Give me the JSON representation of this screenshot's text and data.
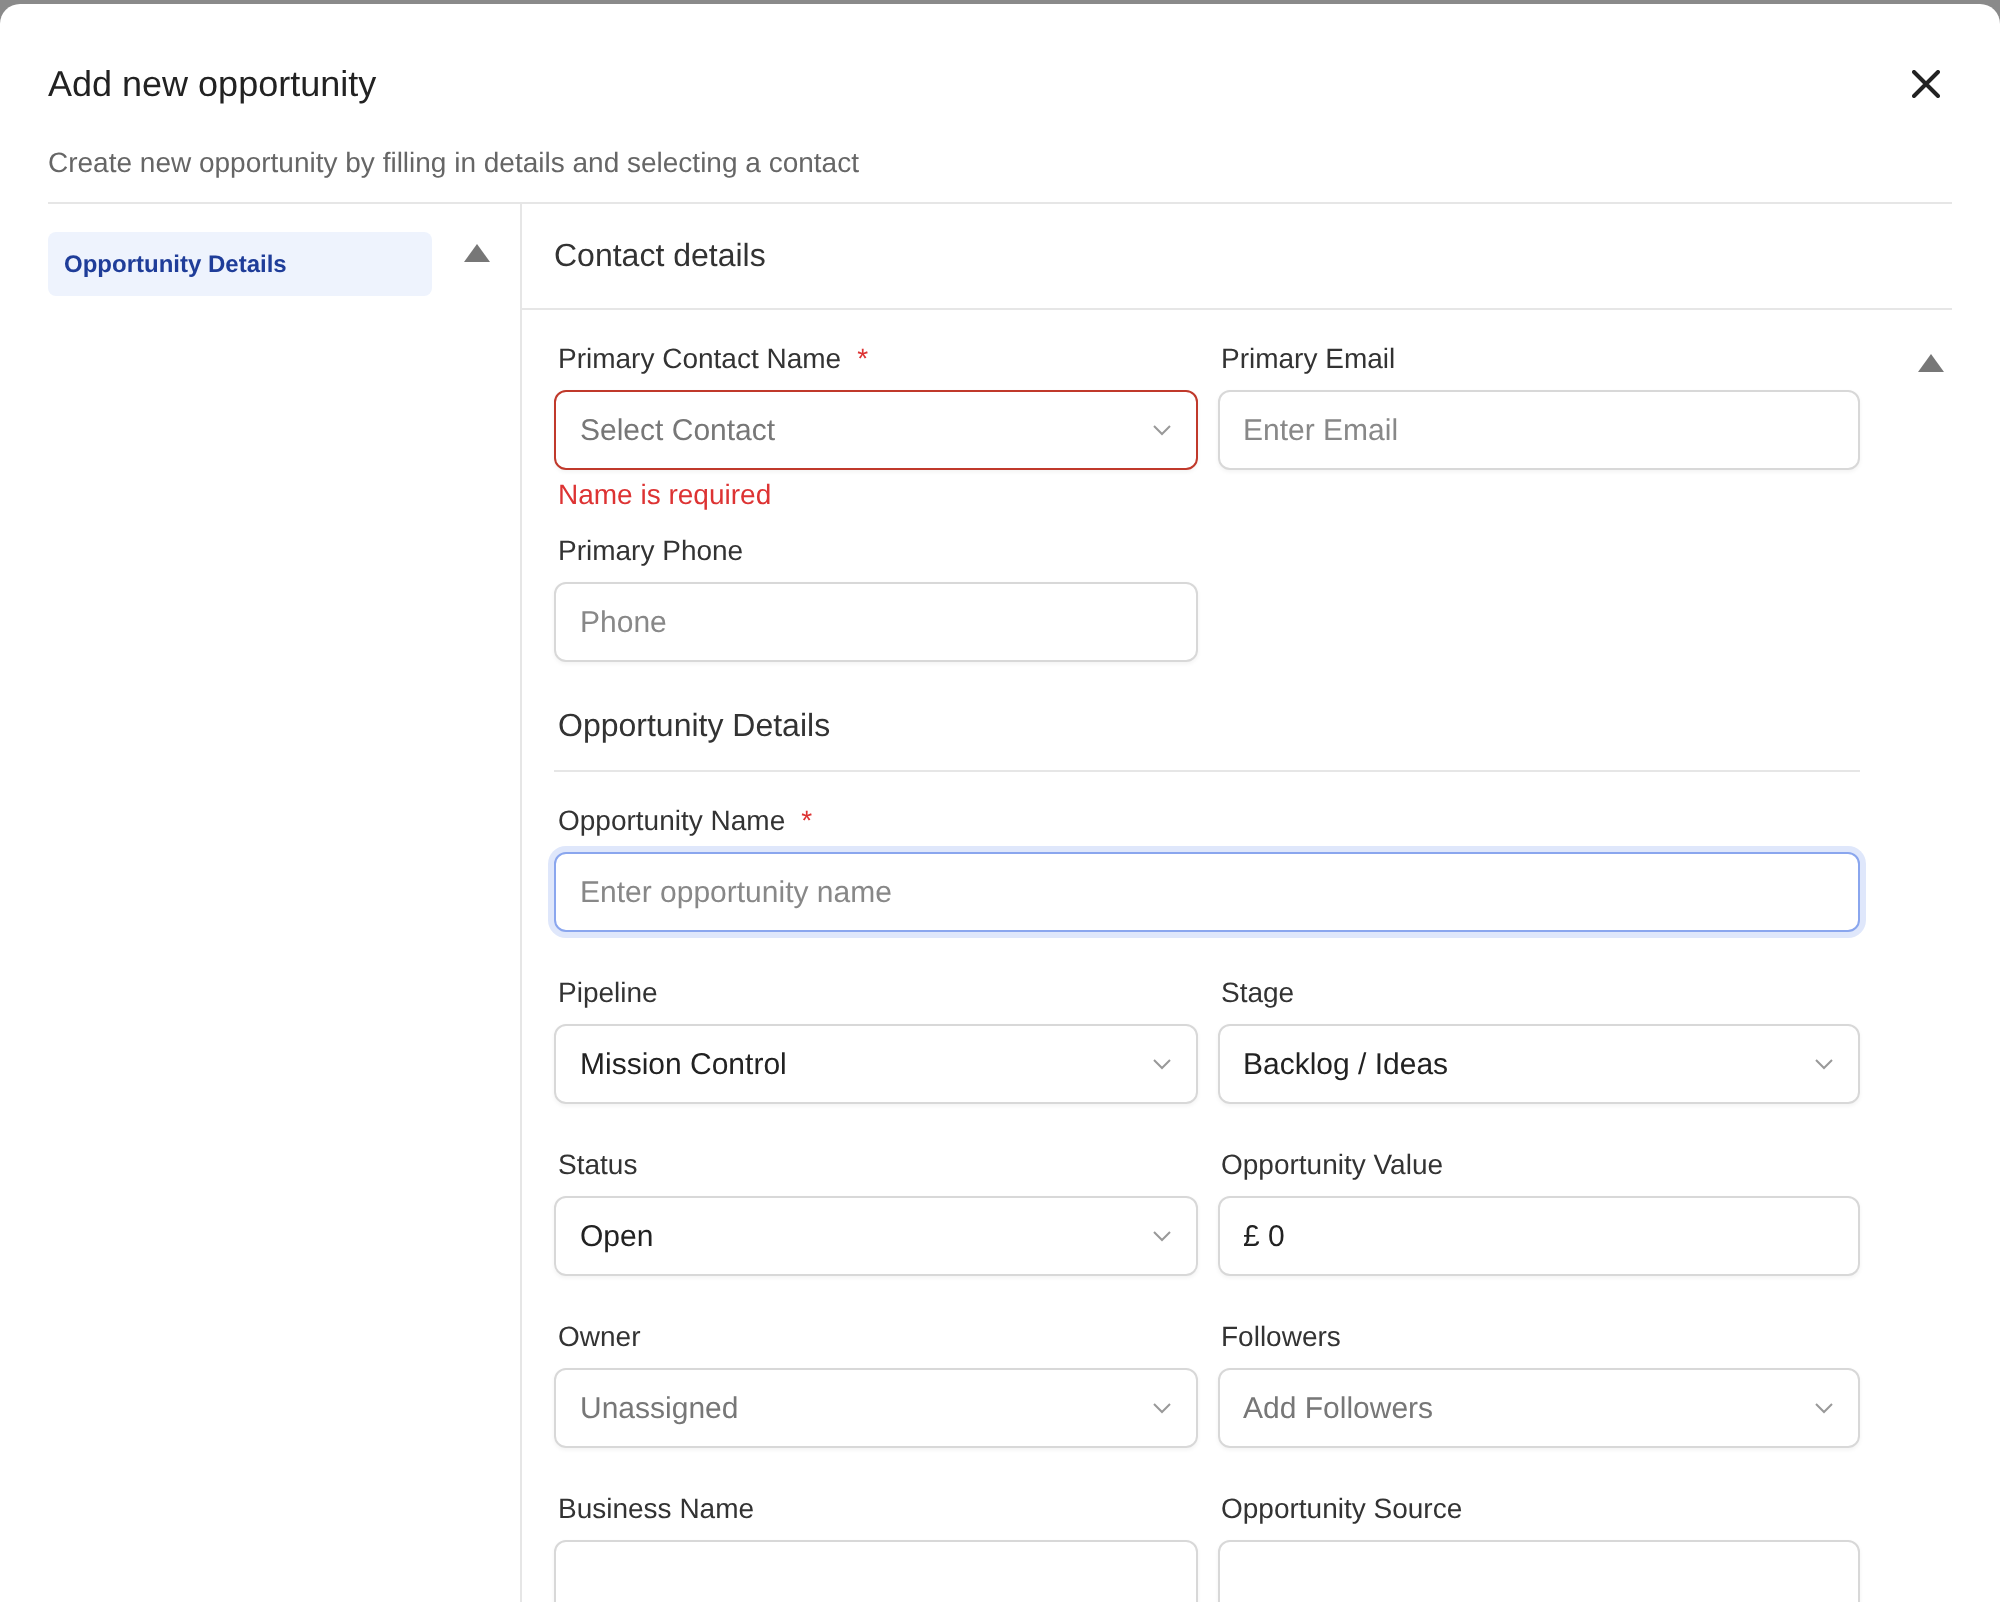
{
  "dialog": {
    "title": "Add new opportunity",
    "subtitle": "Create new opportunity by filling in details and selecting a contact"
  },
  "sidebar": {
    "items": [
      {
        "label": "Opportunity Details",
        "selected": true
      }
    ]
  },
  "sections": [
    {
      "kind": "header",
      "title": "Contact details",
      "fields": [
        {
          "label": "Primary Contact Name",
          "required_mark": "*",
          "kind": "select",
          "placeholder": "Select Contact",
          "error": "Name is required"
        },
        {
          "label": "Primary Email",
          "kind": "input",
          "placeholder": "Enter Email"
        },
        {
          "label": "Primary Phone",
          "kind": "input",
          "placeholder": "Phone"
        }
      ]
    },
    {
      "kind": "subheading",
      "title": "Opportunity Details",
      "fields": [
        {
          "label": "Opportunity Name",
          "required_mark": "*",
          "kind": "input",
          "placeholder": "Enter opportunity name",
          "focused": true,
          "full": true
        },
        {
          "label": "Pipeline",
          "kind": "select",
          "value": "Mission Control"
        },
        {
          "label": "Stage",
          "kind": "select",
          "value": "Backlog / Ideas"
        },
        {
          "label": "Status",
          "kind": "select",
          "value": "Open"
        },
        {
          "label": "Opportunity Value",
          "kind": "input",
          "value": "£ 0"
        },
        {
          "label": "Owner",
          "kind": "select",
          "placeholder": "Unassigned"
        },
        {
          "label": "Followers",
          "kind": "select",
          "placeholder": "Add Followers"
        },
        {
          "label": "Business Name",
          "kind": "input"
        },
        {
          "label": "Opportunity Source",
          "kind": "input"
        }
      ]
    }
  ]
}
